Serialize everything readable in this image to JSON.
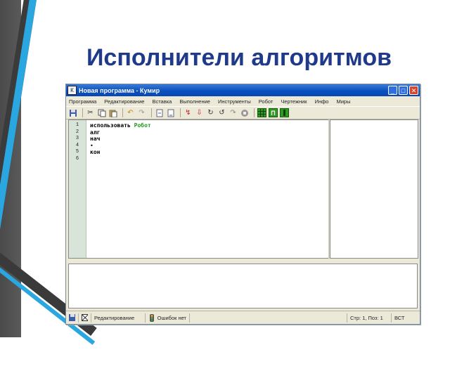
{
  "slide": {
    "title": "Исполнители алгоритмов"
  },
  "window": {
    "title": "Новая программа - Кумир",
    "buttons": {
      "minimize": "_",
      "maximize": "□",
      "close": "✕"
    }
  },
  "menu": [
    "Программа",
    "Редактирование",
    "Вставка",
    "Выполнение",
    "Инструменты",
    "Робот",
    "Чертежник",
    "Инфо",
    "Миры"
  ],
  "toolbar": {
    "icons": [
      "save-icon",
      "cut-icon",
      "copy-icon",
      "paste-icon",
      "undo-icon",
      "redo-icon",
      "indent-icon",
      "outdent-icon",
      "run-icon",
      "step-icon",
      "step-into-icon",
      "step-out-icon",
      "stop-icon",
      "pause-icon"
    ],
    "robot_buttons": [
      "",
      "П",
      ""
    ]
  },
  "editor": {
    "line_numbers": [
      "1",
      "2",
      "3",
      "4",
      "5",
      "6"
    ],
    "lines": [
      {
        "kw": "использовать",
        "arg": "Робот"
      },
      {
        "kw": "алг",
        "arg": ""
      },
      {
        "kw": "нач",
        "arg": ""
      },
      {
        "kw": "•",
        "arg": ""
      },
      {
        "kw": "кон",
        "arg": ""
      }
    ]
  },
  "status": {
    "mode": "Редактирование",
    "state": "Ошибок нет",
    "position": "Стр: 1, Поз: 1",
    "lang": "ВСТ"
  }
}
